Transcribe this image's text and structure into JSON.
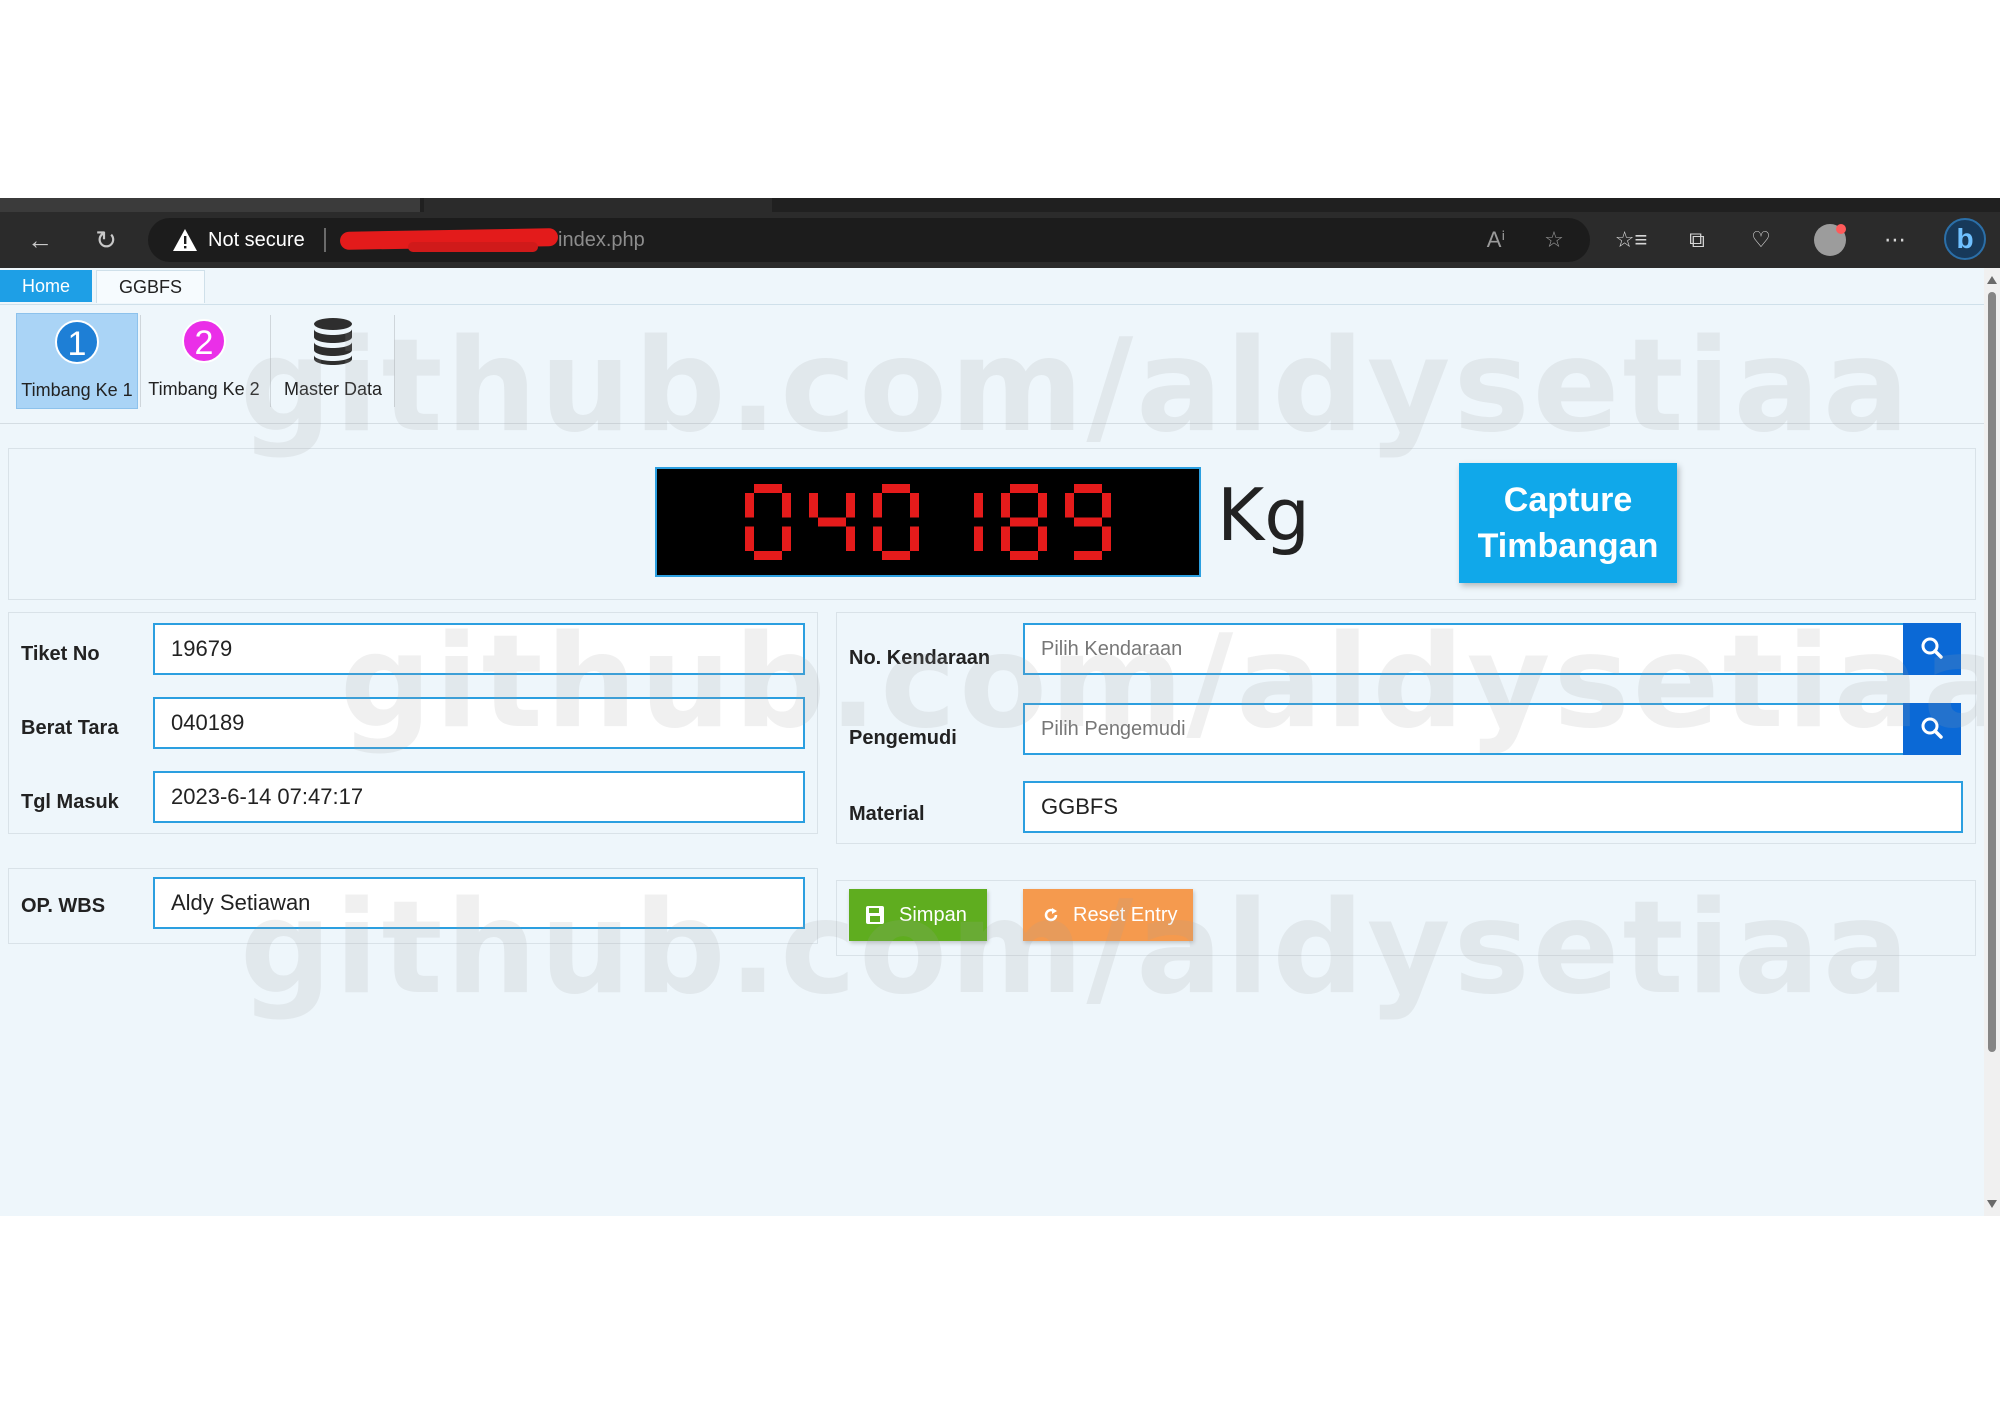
{
  "browser": {
    "security_label": "Not secure",
    "url_visible": "index.php",
    "icons": [
      "back-arrow-icon",
      "refresh-icon",
      "warning-icon",
      "read-aloud-icon",
      "favorite-star-icon",
      "favorites-icon",
      "collections-icon",
      "browser-essentials-icon",
      "profile-icon",
      "more-icon",
      "bing-icon"
    ]
  },
  "tabs": [
    {
      "label": "Home",
      "active": true
    },
    {
      "label": "GGBFS",
      "active": false
    }
  ],
  "ribbon": [
    {
      "label": "Timbang Ke 1",
      "icon_text": "1",
      "selected": true
    },
    {
      "label": "Timbang Ke 2",
      "icon_text": "2",
      "selected": false
    },
    {
      "label": "Master Data",
      "icon": "database-icon",
      "selected": false
    }
  ],
  "watermark": "github.com/aldysetiaa",
  "scale": {
    "display_value": "040189",
    "unit": "Kg",
    "capture_line1": "Capture",
    "capture_line2": "Timbangan",
    "display_color": "#e51b1b"
  },
  "form_left": {
    "tiket_label": "Tiket No",
    "tiket_value": "19679",
    "tara_label": "Berat Tara",
    "tara_value": "040189",
    "tgl_label": "Tgl Masuk",
    "tgl_value": "2023-6-14 07:47:17"
  },
  "form_right": {
    "kendaraan_label": "No. Kendaraan",
    "kendaraan_placeholder": "Pilih Kendaraan",
    "pengemudi_label": "Pengemudi",
    "pengemudi_placeholder": "Pilih Pengemudi",
    "material_label": "Material",
    "material_value": "GGBFS"
  },
  "operator": {
    "label": "OP. WBS",
    "value": "Aldy Setiawan"
  },
  "actions": {
    "save_label": "Simpan",
    "reset_label": "Reset Entry"
  },
  "colors": {
    "accent": "#1e9fe6",
    "save": "#5fad1f",
    "reset": "#f59a4e",
    "search": "#0b69d6"
  }
}
